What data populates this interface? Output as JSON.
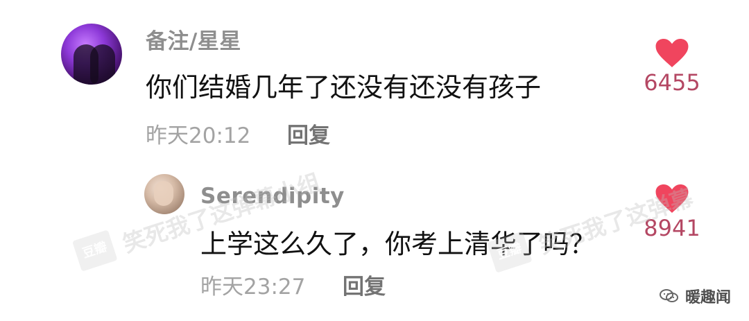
{
  "comments": [
    {
      "username": "备注/星星",
      "text": "你们结婚几年了还没有还没有孩子",
      "time": "昨天20:12",
      "reply_label": "回复",
      "likes": "6455",
      "avatar_icon": "couple-avatar"
    },
    {
      "username": "Serendipity",
      "text": "上学这么久了，你考上清华了吗？",
      "time": "昨天23:27",
      "reply_label": "回复",
      "likes": "8941",
      "avatar_icon": "person-avatar"
    }
  ],
  "watermarks": {
    "left_badge": "豆瓣",
    "left_text": "笑死我了这弹幕小组",
    "right_badge": "豆瓣",
    "right_text": "笑死我了这弹幕"
  },
  "brand": {
    "name": "暖趣闻",
    "icon": "wechat-icon"
  },
  "colors": {
    "heart": "#f0455e",
    "like_count": "#b44763",
    "username": "#8e8e8e",
    "meta": "#a3a3a3"
  }
}
